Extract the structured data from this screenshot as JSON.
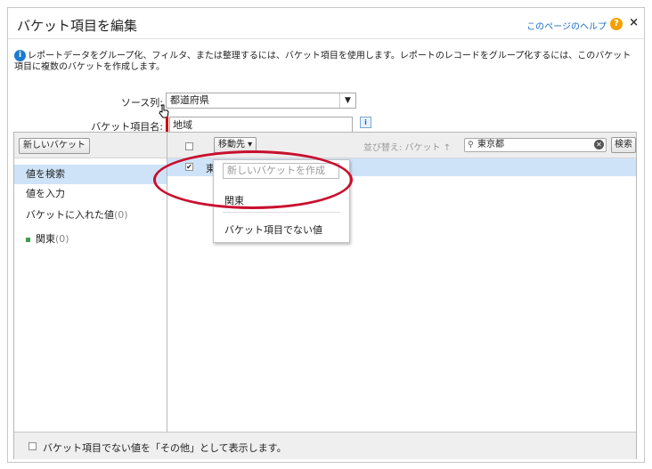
{
  "dialog": {
    "title": "バケット項目を編集",
    "help_link": "このページのヘルプ",
    "help_icon": "?",
    "close": "×"
  },
  "info": {
    "icon": "i",
    "text": "レポートデータをグループ化、フィルタ、または整理するには、バケット項目を使用します。レポートのレコードをグループ化するには、このバケット項目に複数のバケットを作成します。"
  },
  "form": {
    "source_label": "ソース列:",
    "source_value": "都道府県",
    "bucket_name_label": "バケット項目名:",
    "bucket_name_value": "地域",
    "info_icon": "i"
  },
  "left": {
    "new_bucket_button": "新しいバケット",
    "items": [
      {
        "label": "値を検索",
        "count": ""
      },
      {
        "label": "値を入力",
        "count": ""
      },
      {
        "label": "バケットに入れた値",
        "count": "(0)"
      },
      {
        "label": "関東",
        "count": "(0)"
      }
    ]
  },
  "right": {
    "move_button": "移動先 ▾",
    "sort_label": "並び替え: バケット ↑",
    "search_value": "東京都",
    "search_button": "検索",
    "row_text": "東",
    "row_checked": "✔"
  },
  "menu": {
    "new_bucket_placeholder": "新しいバケットを作成",
    "item1": "関東",
    "item2": "バケット項目でない値"
  },
  "footer": {
    "checkbox_label": "バケット項目でない値を「その他」として表示します。"
  },
  "colors": {
    "selected_bg": "#cfe3f8",
    "annotation_red": "#c8102e",
    "help_link": "#1a6ec2"
  }
}
